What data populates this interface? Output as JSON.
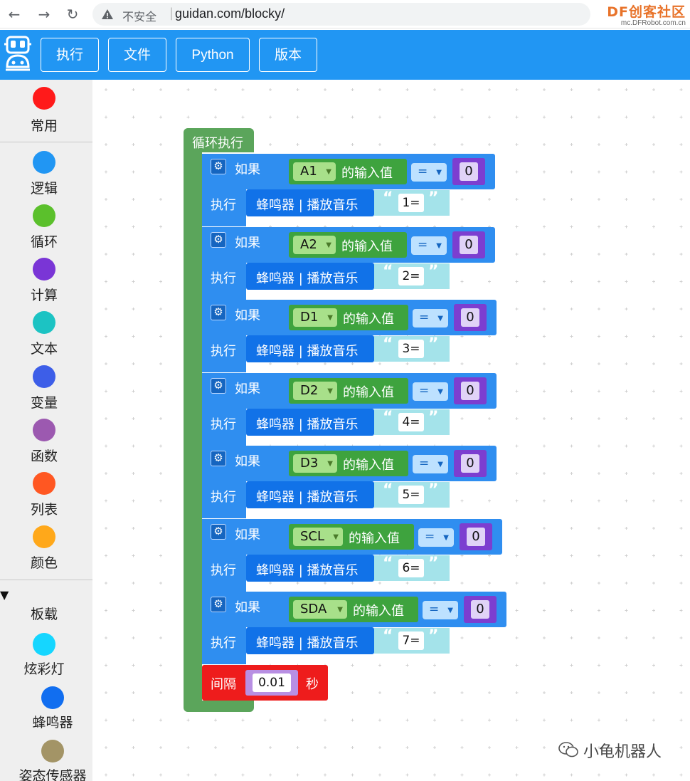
{
  "browser": {
    "insecure_label": "不安全",
    "url": "guidan.com/blocky/",
    "logo_main": "DF创客社区",
    "logo_sub": "mc.DFRobot.com.cn"
  },
  "header": {
    "menu": [
      "执行",
      "文件",
      "Python",
      "版本"
    ]
  },
  "sidebar": {
    "categories": [
      {
        "label": "常用",
        "color": "#ff1a1a"
      },
      {
        "label": "逻辑",
        "color": "#2196f3"
      },
      {
        "label": "循环",
        "color": "#5bc02c"
      },
      {
        "label": "计算",
        "color": "#7a35d6"
      },
      {
        "label": "文本",
        "color": "#1cc3c3"
      },
      {
        "label": "变量",
        "color": "#3d5ee8"
      },
      {
        "label": "函数",
        "color": "#9c59b0"
      },
      {
        "label": "列表",
        "color": "#ff5722"
      },
      {
        "label": "颜色",
        "color": "#ffa81a"
      },
      {
        "label": "板载",
        "color": ""
      },
      {
        "label": "炫彩灯",
        "color": "#15d6ff"
      },
      {
        "label": "蜂鸣器",
        "color": "#116ef0"
      },
      {
        "label": "姿态传感器",
        "color": "#a39466"
      }
    ]
  },
  "program": {
    "loop_label": "循环执行",
    "if_label": "如果",
    "do_label": "执行",
    "input_suffix": "的输入值",
    "buzzer_label": "蜂鸣器 | 播放音乐",
    "rules": [
      {
        "pin": "A1",
        "op": "=",
        "value": "0",
        "note": "1="
      },
      {
        "pin": "A2",
        "op": "=",
        "value": "0",
        "note": "2="
      },
      {
        "pin": "D1",
        "op": "=",
        "value": "0",
        "note": "3="
      },
      {
        "pin": "D2",
        "op": "=",
        "value": "0",
        "note": "4="
      },
      {
        "pin": "D3",
        "op": "=",
        "value": "0",
        "note": "5="
      },
      {
        "pin": "SCL",
        "op": "=",
        "value": "0",
        "note": "6="
      },
      {
        "pin": "SDA",
        "op": "=",
        "value": "0",
        "note": "7="
      }
    ],
    "delay_label": "间隔",
    "delay_value": "0.01",
    "delay_unit": "秒"
  },
  "watermark": "小龟机器人"
}
